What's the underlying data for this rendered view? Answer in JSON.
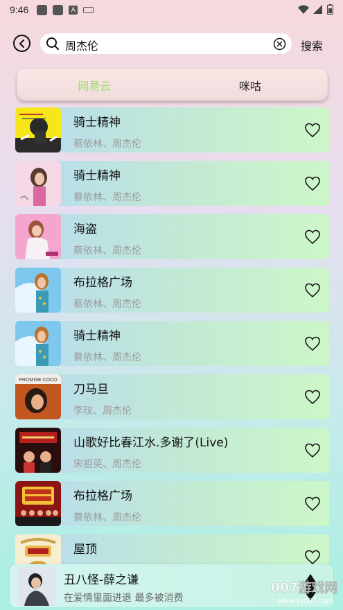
{
  "status_bar": {
    "time": "9:46",
    "notif_icon": "A"
  },
  "search": {
    "value": "周杰伦",
    "submit_label": "搜索"
  },
  "tabs": [
    {
      "label": "网易云",
      "active": true
    },
    {
      "label": "咪咕",
      "active": false
    }
  ],
  "songs": [
    {
      "title": "骑士精神",
      "artist": "蔡依林、周杰伦",
      "cover_text": ""
    },
    {
      "title": "骑士精神",
      "artist": "蔡依林、周杰伦",
      "cover_text": ""
    },
    {
      "title": "海盗",
      "artist": "蔡依林、周杰伦",
      "cover_text": ""
    },
    {
      "title": "布拉格广场",
      "artist": "蔡依林、周杰伦",
      "cover_text": ""
    },
    {
      "title": "骑士精神",
      "artist": "蔡依林、周杰伦",
      "cover_text": ""
    },
    {
      "title": "刀马旦",
      "artist": "李玟、周杰伦",
      "cover_text": "PROMISE COCO"
    },
    {
      "title": "山歌好比春江水.多谢了(Live)",
      "artist": "宋祖英、周杰伦",
      "cover_text": ""
    },
    {
      "title": "布拉格广场",
      "artist": "蔡依林、周杰伦",
      "cover_text": ""
    },
    {
      "title": "屋顶",
      "artist": "",
      "cover_text": ""
    }
  ],
  "player": {
    "title": "丑八怪-薛之谦",
    "subtitle": "在爱情里面进退 最多被消费"
  },
  "watermark": {
    "line1": "007游戏网",
    "line2": "www.yx007.com"
  },
  "colors": {
    "active_tab": "#9be06a",
    "accent_green": "#cdf7c8",
    "accent_blue": "#b7dbf0"
  }
}
